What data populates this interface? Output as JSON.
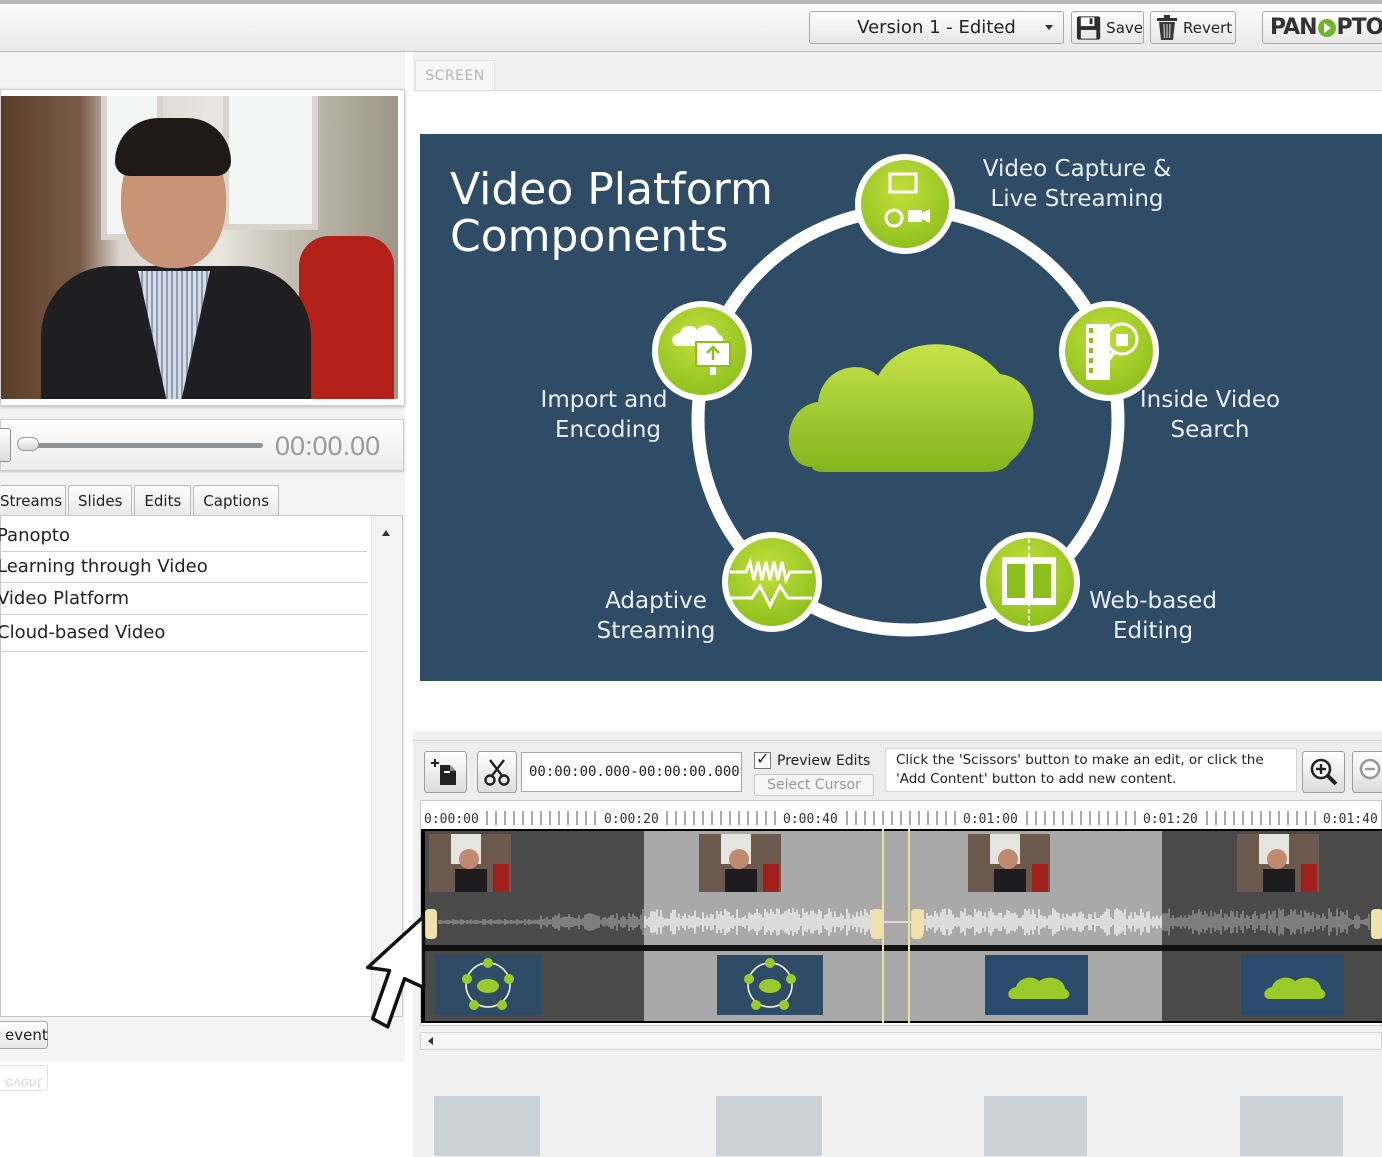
{
  "toolbar": {
    "version_label": "Version 1 - Edited",
    "save_label": "Save",
    "revert_label": "Revert",
    "logo_pre": "PAN",
    "logo_post": "PTO"
  },
  "player": {
    "time": "00:00.00"
  },
  "tabs": [
    "Streams",
    "Slides",
    "Edits",
    "Captions"
  ],
  "list_items": [
    "Panopto",
    "Learning through Video",
    "Video Platform",
    "Cloud-based Video"
  ],
  "event_button": "event",
  "screen_tab": "SCREEN",
  "slide": {
    "title_line1": "Video Platform",
    "title_line2": "Components",
    "labels": {
      "capture_1": "Video Capture &",
      "capture_2": "Live Streaming",
      "search_1": "Inside Video",
      "search_2": "Search",
      "import_1": "Import and",
      "import_2": "Encoding",
      "adaptive_1": "Adaptive",
      "adaptive_2": "Streaming",
      "editing_1": "Web-based",
      "editing_2": "Editing"
    }
  },
  "edit_toolbar": {
    "timecode": "00:00:00.000-00:00:00.000",
    "preview_edits_label": "Preview Edits",
    "preview_edits_checked": true,
    "select_cursor_label": "Select Cursor",
    "hint_line1": "Click the 'Scissors' button to make an edit, or click the",
    "hint_line2": "'Add Content' button to add new content."
  },
  "timeline": {
    "ruler_labels": [
      "0:00:00",
      "0:00:20",
      "0:00:40",
      "0:01:00",
      "0:01:20",
      "0:01:40"
    ]
  },
  "colors": {
    "slide_bg": "#2f4c66",
    "accent_green": "#9acb2b",
    "logo_green": "#6fb52c"
  }
}
